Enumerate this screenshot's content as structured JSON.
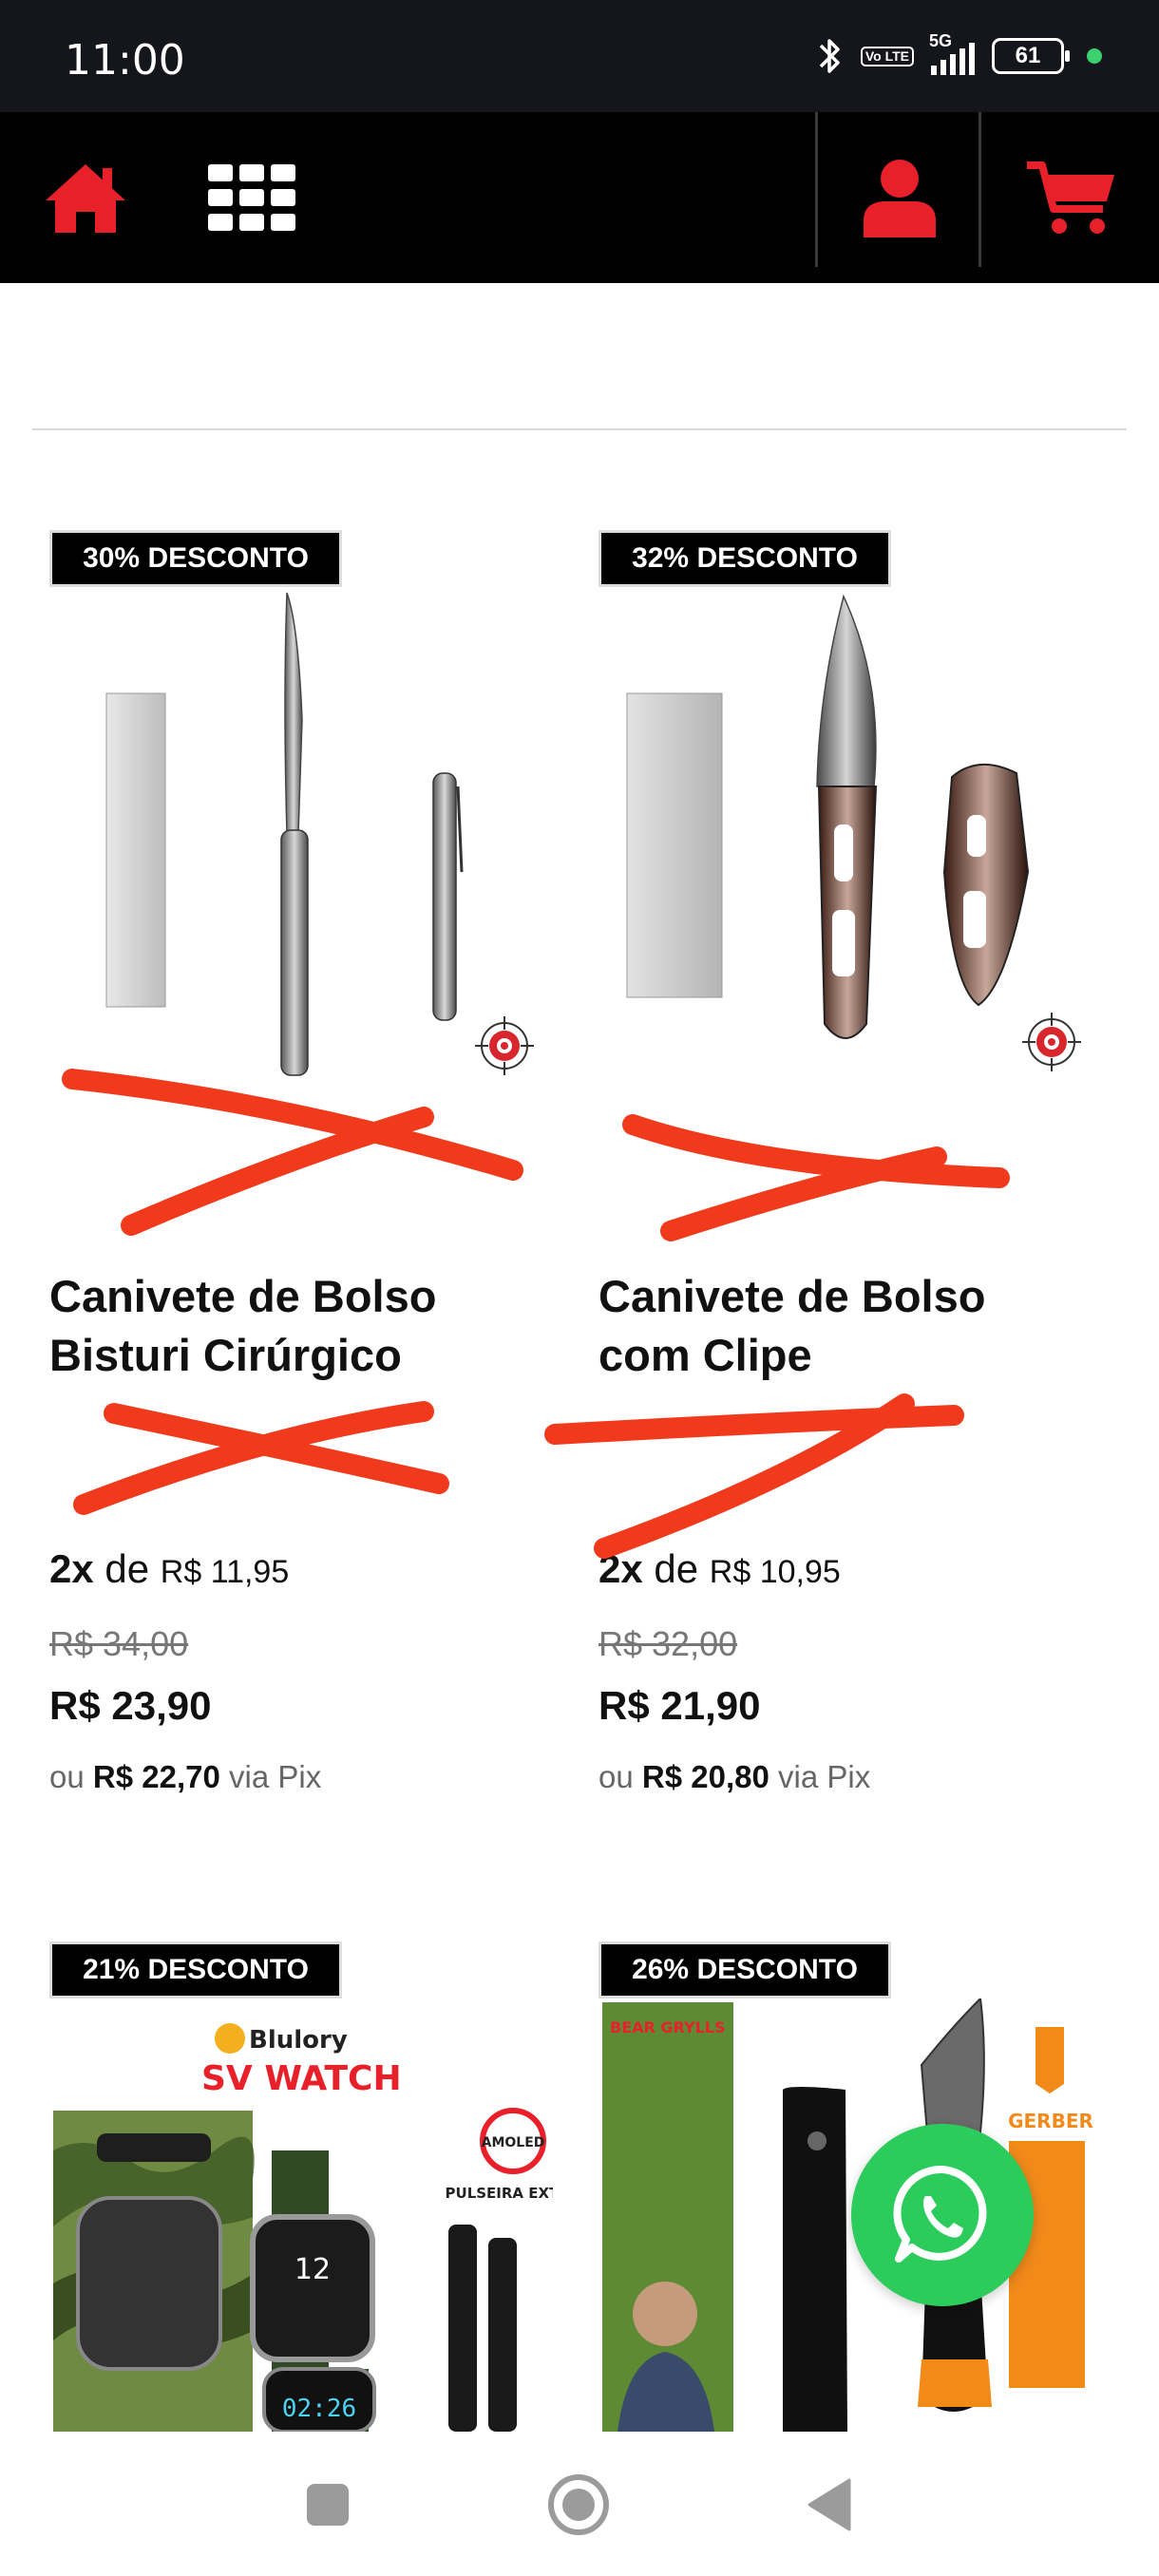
{
  "status_bar": {
    "time": "11:00",
    "network": "5G",
    "volte": "Vo LTE",
    "battery": "61",
    "icons": [
      "bluetooth-icon",
      "volte-icon",
      "signal-icon",
      "battery-icon",
      "privacy-dot-icon"
    ]
  },
  "nav": {
    "icons": [
      "home-icon",
      "grid-menu-icon",
      "user-icon",
      "cart-icon"
    ],
    "accent_color": "#e8202a"
  },
  "products": [
    {
      "badge": "30% DESCONTO",
      "title_line1": "Canivete de Bolso",
      "title_line2": "Bisturi Cirúrgico",
      "installment_count": "2x",
      "installment_de": "de",
      "installment_value": "R$ 11,95",
      "old_price": "R$ 34,00",
      "price": "R$ 23,90",
      "pix_prefix": "ou",
      "pix_price": "R$ 22,70",
      "pix_suffix": "via Pix"
    },
    {
      "badge": "32% DESCONTO",
      "title_line1": "Canivete de Bolso",
      "title_line2": "com Clipe",
      "installment_count": "2x",
      "installment_de": "de",
      "installment_value": "R$ 10,95",
      "old_price": "R$ 32,00",
      "price": "R$ 21,90",
      "pix_prefix": "ou",
      "pix_price": "R$ 20,80",
      "pix_suffix": "via Pix"
    },
    {
      "badge": "21% DESCONTO",
      "image_text": {
        "brand": "Blulory",
        "product": "SV WATCH",
        "badge": "AMOLED",
        "strap": "PULSEIRA EXTRA",
        "time1": "12",
        "time2": "02:26"
      }
    },
    {
      "badge": "26% DESCONTO",
      "image_text": {
        "brand": "GERBER",
        "series": "BEAR GRYLLS"
      }
    }
  ],
  "floating": {
    "icon": "whatsapp-icon",
    "color": "#2bcc5c"
  },
  "system_nav": {
    "icons": [
      "recents-icon",
      "home-circle-icon",
      "back-icon"
    ]
  }
}
